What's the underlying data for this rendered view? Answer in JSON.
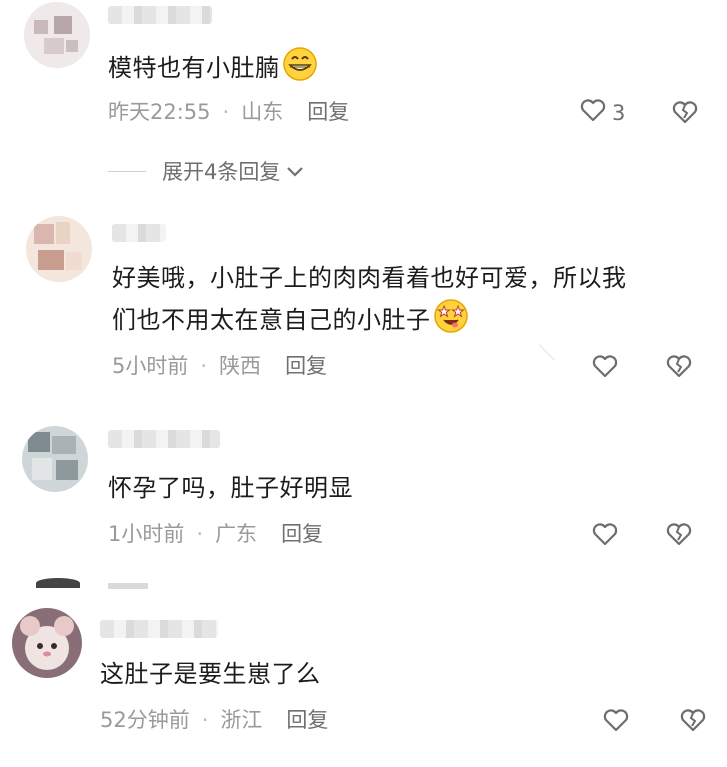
{
  "comments": [
    {
      "text": "模特也有小肚腩",
      "time": "昨天22:55",
      "location": "山东",
      "reply_label": "回复",
      "like_count": "3",
      "emoji": "grinning-face"
    },
    {
      "text_line1": "好美哦，小肚子上的肉肉看着也好可爱，所以我",
      "text_line2": "们也不用太在意自己的小肚子",
      "time": "5小时前",
      "location": "陕西",
      "reply_label": "回复",
      "emoji": "star-struck-face"
    },
    {
      "text": "怀孕了吗，肚子好明显",
      "time": "1小时前",
      "location": "广东",
      "reply_label": "回复"
    },
    {
      "text": "这肚子是要生崽了么",
      "time": "52分钟前",
      "location": "浙江",
      "reply_label": "回复"
    }
  ],
  "expand_replies_label": "展开4条回复",
  "meta_separator": "·",
  "colors": {
    "text": "#1c1c1c",
    "meta": "#9a9a9a",
    "icon": "#6d6d6d"
  }
}
